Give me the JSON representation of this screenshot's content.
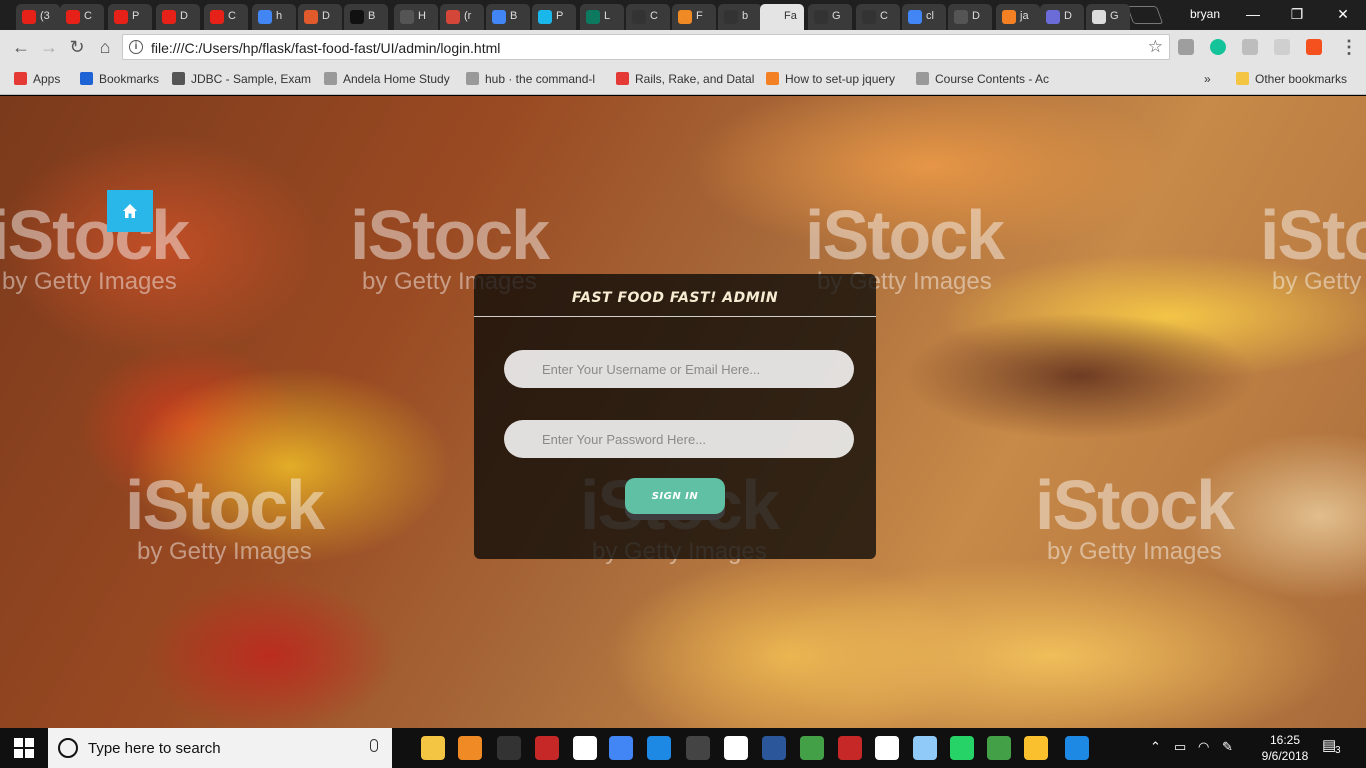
{
  "tabs": [
    {
      "label": "(3",
      "color": "#e62117"
    },
    {
      "label": "C",
      "color": "#e62117"
    },
    {
      "label": "P",
      "color": "#e62117"
    },
    {
      "label": "D",
      "color": "#e62117"
    },
    {
      "label": "C",
      "color": "#e62117"
    },
    {
      "label": "h",
      "color": "#4285f4"
    },
    {
      "label": "D",
      "color": "#e05a2b"
    },
    {
      "label": "B",
      "color": "#111111"
    },
    {
      "label": "H",
      "color": "#555555"
    },
    {
      "label": "(r",
      "color": "#d44638"
    },
    {
      "label": "B",
      "color": "#4285f4"
    },
    {
      "label": "P",
      "color": "#1ab7ea"
    },
    {
      "label": "L",
      "color": "#0d7a5f"
    },
    {
      "label": "C",
      "color": "#333333"
    },
    {
      "label": "F",
      "color": "#f08a24"
    },
    {
      "label": "b",
      "color": "#333333"
    },
    {
      "label": "Fa",
      "color": "#e4e4e4",
      "active": true
    },
    {
      "label": "G",
      "color": "#333333"
    },
    {
      "label": "C",
      "color": "#333333"
    },
    {
      "label": "cl",
      "color": "#4285f4"
    },
    {
      "label": "D",
      "color": "#555555"
    },
    {
      "label": "ja",
      "color": "#f48024"
    },
    {
      "label": "D",
      "color": "#6c6cd8"
    },
    {
      "label": "G",
      "color": "#dddddd"
    }
  ],
  "window": {
    "user": "bryan",
    "minimize": "—",
    "restore": "❐",
    "close": "✕"
  },
  "nav": {
    "back": "←",
    "forward": "→",
    "reload": "↻",
    "home": "⌂",
    "url": "file:///C:/Users/hp/flask/fast-food-fast/UI/admin/login.html",
    "info_icon": "i",
    "star_icon": "☆"
  },
  "bookmarks": [
    {
      "label": "Apps",
      "color": "#e53935"
    },
    {
      "label": "Bookmarks",
      "color": "#1e63d6"
    },
    {
      "label": "JDBC - Sample, Exam",
      "color": "#555555"
    },
    {
      "label": "Andela Home Study",
      "color": "#999999"
    },
    {
      "label": "hub · the command-l",
      "color": "#999999"
    },
    {
      "label": "Rails, Rake, and Datal",
      "color": "#e53935"
    },
    {
      "label": "How to set-up jquery",
      "color": "#f48024"
    },
    {
      "label": "Course Contents - Ac",
      "color": "#999999"
    }
  ],
  "bookmarks_overflow": "»",
  "other_bookmarks": "Other bookmarks",
  "watermark": {
    "brand": "iStock",
    "sub": "by Getty Images"
  },
  "login": {
    "title": "FAST FOOD FAST! ADMIN",
    "username_placeholder": "Enter Your Username or Email Here...",
    "password_placeholder": "Enter Your Password Here...",
    "submit": "SIGN IN"
  },
  "taskbar": {
    "search_placeholder": "Type here to search",
    "time": "16:25",
    "date": "9/6/2018",
    "notifications": "3",
    "apps": [
      {
        "name": "file-explorer",
        "color": "#f4c542"
      },
      {
        "name": "vlc",
        "color": "#f08a24"
      },
      {
        "name": "terminal",
        "color": "#333333"
      },
      {
        "name": "app-red",
        "color": "#c62828"
      },
      {
        "name": "notes",
        "color": "#ffffff"
      },
      {
        "name": "chrome",
        "color": "#4285f4"
      },
      {
        "name": "vscode",
        "color": "#1e88e5"
      },
      {
        "name": "terminal-2",
        "color": "#444444"
      },
      {
        "name": "slack",
        "color": "#ffffff"
      },
      {
        "name": "word",
        "color": "#2b579a"
      },
      {
        "name": "spinner",
        "color": "#43a047"
      },
      {
        "name": "red-app",
        "color": "#c62828"
      },
      {
        "name": "smile",
        "color": "#ffffff"
      },
      {
        "name": "monitor",
        "color": "#90caf9"
      },
      {
        "name": "whatsapp",
        "color": "#25d366"
      },
      {
        "name": "green-plus",
        "color": "#43a047"
      },
      {
        "name": "paint",
        "color": "#fbc02d"
      },
      {
        "name": "help",
        "color": "#1e88e5"
      }
    ]
  }
}
